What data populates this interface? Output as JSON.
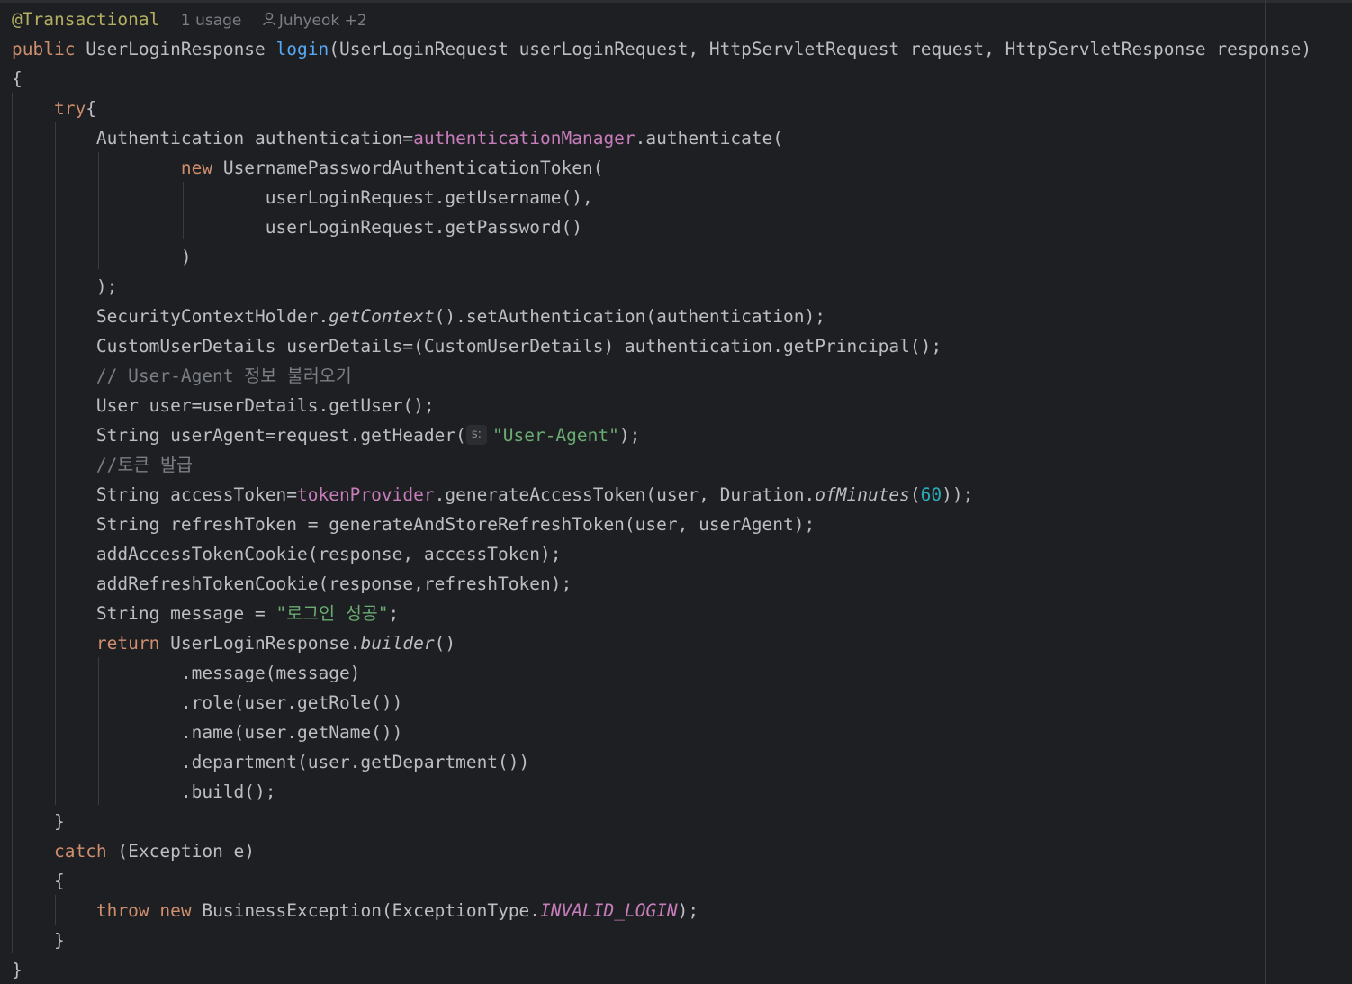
{
  "inlay": {
    "annotation": "@Transactional",
    "usages": "1 usage",
    "author": "Juhyeok +2"
  },
  "code": {
    "l2_public": "public",
    "l2_type": "UserLoginResponse",
    "l2_name": "login",
    "l2_params": "(UserLoginRequest userLoginRequest, HttpServletRequest request, HttpServletResponse response)",
    "l3": "{",
    "l4_try": "try",
    "l4_brace": "{",
    "l5_a": "Authentication authentication=",
    "l5_field": "authenticationManager",
    "l5_b": ".authenticate(",
    "l6_new": "new",
    "l6_rest": "UsernamePasswordAuthenticationToken(",
    "l7": "userLoginRequest.getUsername(),",
    "l8": "userLoginRequest.getPassword()",
    "l9": ")",
    "l10": ");",
    "l11_a": "SecurityContextHolder.",
    "l11_static": "getContext",
    "l11_b": "().setAuthentication(authentication);",
    "l12": "CustomUserDetails userDetails=(CustomUserDetails) authentication.getPrincipal();",
    "l13": "// User-Agent 정보 불러오기",
    "l14": "User user=userDetails.getUser();",
    "l15_a": "String userAgent=request.getHeader(",
    "l15_hint": "s:",
    "l15_str": "\"User-Agent\"",
    "l15_b": ");",
    "l16": "//토큰 발급",
    "l17_a": "String accessToken=",
    "l17_field": "tokenProvider",
    "l17_b": ".generateAccessToken(user, Duration.",
    "l17_static": "ofMinutes",
    "l17_c": "(",
    "l17_num": "60",
    "l17_d": "));",
    "l18": "String refreshToken = generateAndStoreRefreshToken(user, userAgent);",
    "l19": "addAccessTokenCookie(response, accessToken);",
    "l20": "addRefreshTokenCookie(response,refreshToken);",
    "l21_a": "String message = ",
    "l21_str": "\"로그인 성공\"",
    "l21_b": ";",
    "l22_return": "return",
    "l22_a": "UserLoginResponse.",
    "l22_static": "builder",
    "l22_b": "()",
    "l23": ".message(message)",
    "l24": ".role(user.getRole())",
    "l25": ".name(user.getName())",
    "l26": ".department(user.getDepartment())",
    "l27": ".build();",
    "l28": "}",
    "l29_catch": "catch",
    "l29_rest": "(Exception e)",
    "l30": "{",
    "l31_throw": "throw",
    "l31_new": "new",
    "l31_a": "BusinessException(ExceptionType.",
    "l31_const": "INVALID_LOGIN",
    "l31_b": ");",
    "l32": "}",
    "l33": "}"
  },
  "colors": {
    "background": "#1e1f22",
    "keyword": "#cf8e6d",
    "annotation": "#b3ae60",
    "method": "#56a8f5",
    "field": "#c77dbb",
    "string": "#6aab73",
    "number": "#2aacb8",
    "comment": "#7a7e85",
    "text": "#bcbec4"
  }
}
